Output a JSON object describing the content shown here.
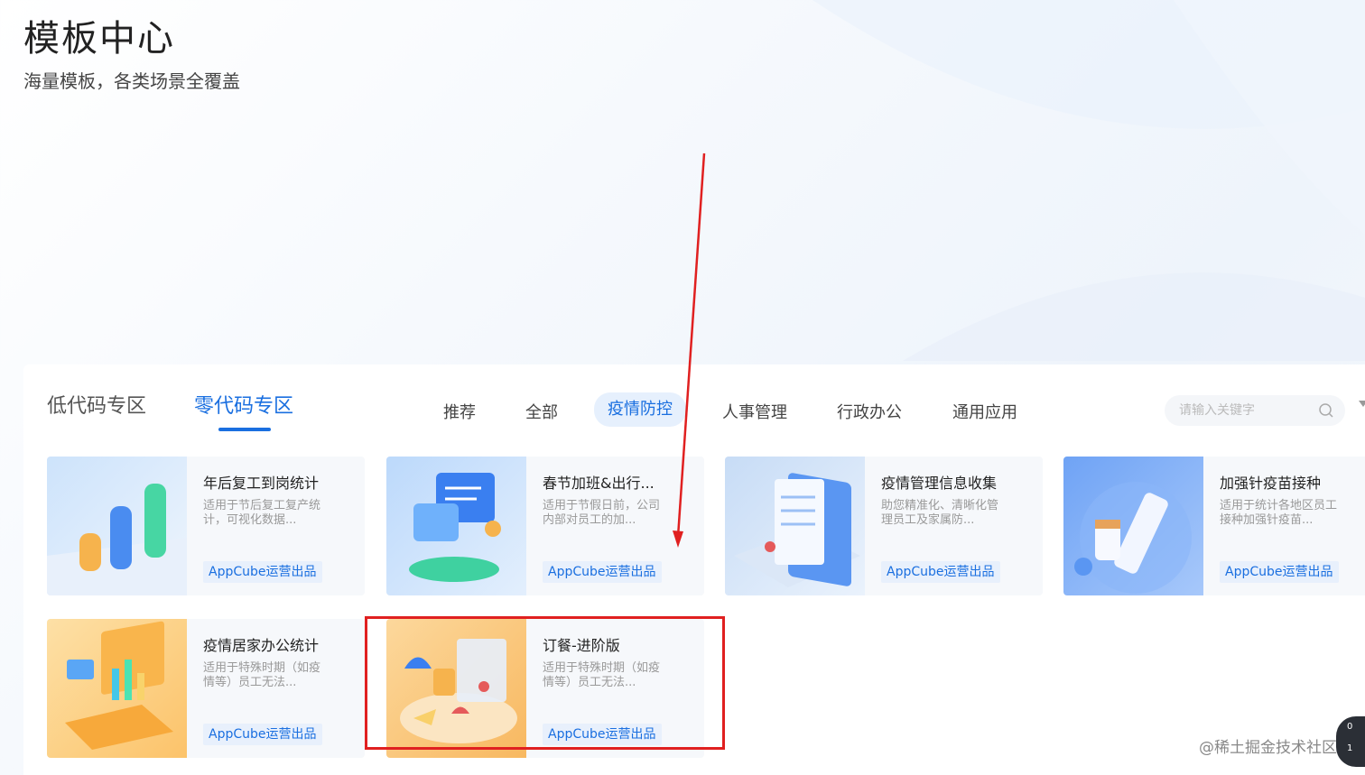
{
  "hero": {
    "title": "模板中心",
    "subtitle": "海量模板，各类场景全覆盖"
  },
  "zones": {
    "low_code": "低代码专区",
    "zero_code": "零代码专区",
    "active": "零代码专区"
  },
  "categories": [
    {
      "label": "推荐",
      "active": false
    },
    {
      "label": "全部",
      "active": false
    },
    {
      "label": "疫情防控",
      "active": true
    },
    {
      "label": "人事管理",
      "active": false
    },
    {
      "label": "行政办公",
      "active": false
    },
    {
      "label": "通用应用",
      "active": false
    }
  ],
  "search": {
    "placeholder": "请输入关键字",
    "value": ""
  },
  "cards": [
    {
      "title": "年后复工到岗统计",
      "desc": "适用于节后复工复产统计，可视化数据...",
      "badge": "AppCube运营出品",
      "thumb": "bar-chart-illustration"
    },
    {
      "title": "春节加班&出行...",
      "desc": "适用于节假日前，公司内部对员工的加...",
      "badge": "AppCube运营出品",
      "thumb": "chat-bubble-illustration"
    },
    {
      "title": "疫情管理信息收集",
      "desc": "助您精准化、清晰化管理员工及家属防...",
      "badge": "AppCube运营出品",
      "thumb": "clipboard-illustration"
    },
    {
      "title": "加强针疫苗接种",
      "desc": "适用于统计各地区员工接种加强针疫苗...",
      "badge": "AppCube运营出品",
      "thumb": "vaccine-illustration"
    },
    {
      "title": "疫情居家办公统计",
      "desc": "适用于特殊时期（如疫情等）员工无法...",
      "badge": "AppCube运营出品",
      "thumb": "laptop-illustration"
    },
    {
      "title": "订餐-进阶版",
      "desc": "适用于特殊时期（如疫情等）员工无法...",
      "badge": "AppCube运营出品",
      "thumb": "food-tray-illustration"
    }
  ],
  "colors": {
    "accent": "#1a6fe0",
    "annotation": "#e02020"
  },
  "watermark": "@稀土掘金技术社区",
  "corner_widget": {
    "up": "0",
    "down": "1"
  }
}
